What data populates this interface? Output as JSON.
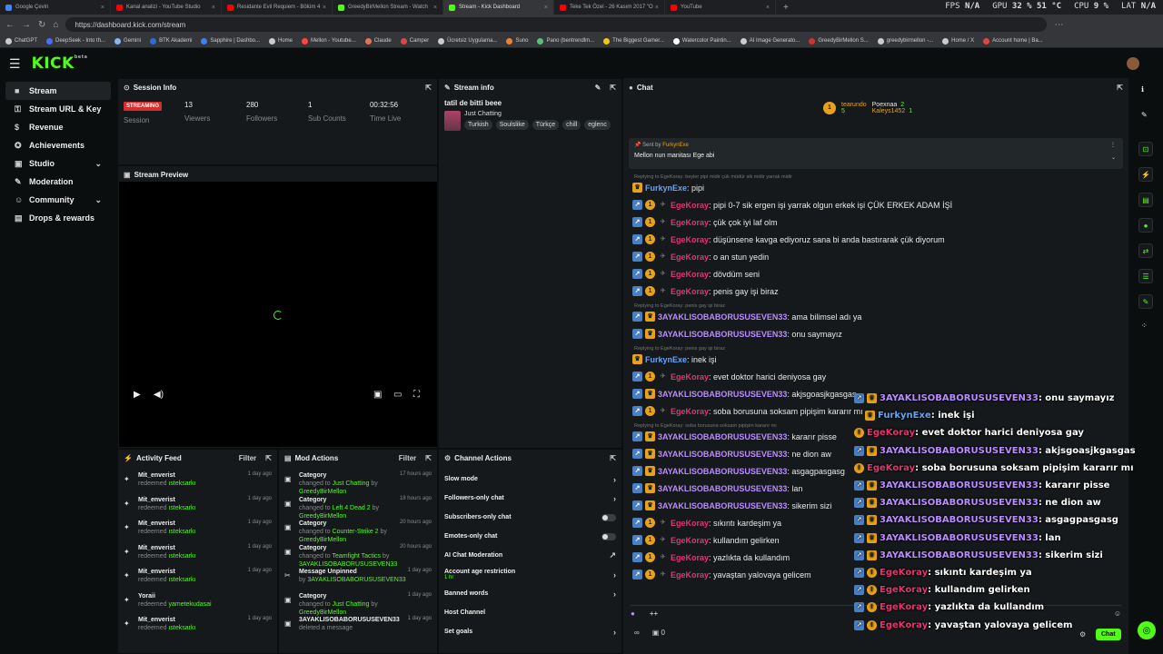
{
  "browser": {
    "tabs": [
      {
        "label": "Google Çeviri",
        "color": "#4285f4",
        "active": false
      },
      {
        "label": "Kanal analizi - YouTube Studio",
        "color": "#ff0000",
        "active": false
      },
      {
        "label": "Residante Evil Requiem - Bölüm 4",
        "color": "#ff0000",
        "active": false
      },
      {
        "label": "GreedyBirMellon Stream - Watch",
        "color": "#53fc18",
        "active": false
      },
      {
        "label": "Stream - Kick Dashboard",
        "color": "#53fc18",
        "active": true
      },
      {
        "label": "Teke Tek Özel - 26 Kasım 2017 \"O",
        "color": "#ff0000",
        "active": false
      },
      {
        "label": "YouTube",
        "color": "#ff0000",
        "active": false
      }
    ],
    "new_tab": "+",
    "url": "https://dashboard.kick.com/stream",
    "hud": {
      "fps_label": "FPS",
      "fps_value": "N/A",
      "gpu_label": "GPU",
      "gpu_value": "32 % 51 °C",
      "cpu_label": "CPU",
      "cpu_value": "9 %",
      "lat_label": "LAT",
      "lat_value": "N/A"
    },
    "bookmarks": [
      {
        "label": "ChatGPT",
        "color": "#ccc"
      },
      {
        "label": "DeepSeek - Into th...",
        "color": "#4d6bfe"
      },
      {
        "label": "Gemini",
        "color": "#8ab4f8"
      },
      {
        "label": "BTK Akademi",
        "color": "#2d6cdf"
      },
      {
        "label": "Sapphire | Dashbo...",
        "color": "#3b82f6"
      },
      {
        "label": "Home",
        "color": "#ccc"
      },
      {
        "label": "Mellon - Youtube...",
        "color": "#ff4444"
      },
      {
        "label": "Claude",
        "color": "#d97757"
      },
      {
        "label": "Camper",
        "color": "#e04545"
      },
      {
        "label": "Ücretsiz Uygulama...",
        "color": "#ccc"
      },
      {
        "label": "Suno",
        "color": "#f08030"
      },
      {
        "label": "Pano (bentrendlm...",
        "color": "#53c47b"
      },
      {
        "label": "The Biggest Gamer...",
        "color": "#f5c518"
      },
      {
        "label": "Watercolor Paintin...",
        "color": "#fff"
      },
      {
        "label": "AI Image Generato...",
        "color": "#ccc"
      },
      {
        "label": "GreedyBirMellon S...",
        "color": "#c33"
      },
      {
        "label": "greedybirmellon -...",
        "color": "#ccc"
      },
      {
        "label": "Home / X",
        "color": "#ccc"
      },
      {
        "label": "Account home | Ba...",
        "color": "#e04545"
      }
    ]
  },
  "brand": {
    "logo": "KICK",
    "logo_sup": "beta",
    "accent": "#53fc18"
  },
  "sidebar": {
    "items": [
      {
        "label": "Stream",
        "icon": "video-icon",
        "glyph": "■",
        "active": true,
        "chevron": false
      },
      {
        "label": "Stream URL & Key",
        "icon": "key-icon",
        "glyph": "⚿",
        "active": false,
        "chevron": false
      },
      {
        "label": "Revenue",
        "icon": "revenue-icon",
        "glyph": "$",
        "active": false,
        "chevron": false
      },
      {
        "label": "Achievements",
        "icon": "trophy-icon",
        "glyph": "✪",
        "active": false,
        "chevron": false
      },
      {
        "label": "Studio",
        "icon": "studio-icon",
        "glyph": "▣",
        "active": false,
        "chevron": true
      },
      {
        "label": "Moderation",
        "icon": "wrench-icon",
        "glyph": "✎",
        "active": false,
        "chevron": false
      },
      {
        "label": "Community",
        "icon": "community-icon",
        "glyph": "☺",
        "active": false,
        "chevron": true
      },
      {
        "label": "Drops & rewards",
        "icon": "gift-icon",
        "glyph": "▤",
        "active": false,
        "chevron": false
      }
    ]
  },
  "session": {
    "title": "Session Info",
    "status": "STREAMING",
    "session_label": "Session",
    "viewers": "13",
    "viewers_label": "Viewers",
    "followers": "280",
    "followers_label": "Followers",
    "subs": "1",
    "subs_label": "Sub Counts",
    "time": "00:32:56",
    "time_label": "Time Live"
  },
  "preview": {
    "title": "Stream Preview"
  },
  "stream_info": {
    "title_label": "Stream info",
    "stream_title": "tatil de bitti beee",
    "category": "Just Chatting",
    "tags": [
      "Turkish",
      "Soulslike",
      "Türkçe",
      "chill",
      "eglenc"
    ]
  },
  "activity": {
    "title": "Activity Feed",
    "filter": "Filter",
    "items": [
      {
        "name": "Mit_enverist",
        "prefix": "redeemed ",
        "item": "ısteksarkı",
        "time": "1 day ago"
      },
      {
        "name": "Mit_enverist",
        "prefix": "redeemed ",
        "item": "ısteksarkı",
        "time": "1 day ago"
      },
      {
        "name": "Mit_enverist",
        "prefix": "redeemed ",
        "item": "ısteksarkı",
        "time": "1 day ago"
      },
      {
        "name": "Mit_enverist",
        "prefix": "redeemed ",
        "item": "ısteksarkı",
        "time": "1 day ago"
      },
      {
        "name": "Mit_enverist",
        "prefix": "redeemed ",
        "item": "ısteksarkı",
        "time": "1 day ago"
      },
      {
        "name": "Yoraii",
        "prefix": "redeemed ",
        "item": "yametekudasai",
        "time": ""
      },
      {
        "name": "Mit_enverist",
        "prefix": "redeemed ",
        "item": "ısteksarkı",
        "time": "1 day ago"
      }
    ]
  },
  "mod_actions": {
    "title": "Mod Actions",
    "filter": "Filter",
    "items": [
      {
        "title": "Category",
        "prefix": "changed to ",
        "target": "Just Chatting",
        "by": " by ",
        "user": "GreedyBirMellon",
        "time": "17 hours ago"
      },
      {
        "title": "Category",
        "prefix": "changed to ",
        "target": "Left 4 Dead 2",
        "by": " by ",
        "user": "GreedyBirMellon",
        "time": "18 hours ago"
      },
      {
        "title": "Category",
        "prefix": "changed to ",
        "target": "Counter-Strike 2",
        "by": " by ",
        "user": "GreedyBirMellon",
        "time": "20 hours ago"
      },
      {
        "title": "Category",
        "prefix": "changed to ",
        "target": "Teamfight Tactics",
        "by": " by ",
        "user": "3AYAKLISOBABORUSUSEVEN33",
        "time": "20 hours ago"
      },
      {
        "title": "Message Unpinned",
        "prefix": "by ",
        "target": "",
        "by": "",
        "user": "3AYAKLISOBABORUSUSEVEN33",
        "time": "1 day ago"
      },
      {
        "title": "Category",
        "prefix": "changed to ",
        "target": "Just Chatting",
        "by": " by ",
        "user": "GreedyBirMellon",
        "time": "1 day ago"
      },
      {
        "title": "3AYAKLISOBABORUSUSEVEN33",
        "prefix": "deleted a message",
        "target": "",
        "by": "",
        "user": "",
        "time": "1 day ago"
      }
    ]
  },
  "channel_actions": {
    "title": "Channel Actions",
    "rows": [
      {
        "label": "Slow mode",
        "control": "›",
        "sub": ""
      },
      {
        "label": "Followers-only chat",
        "control": "›",
        "sub": ""
      },
      {
        "label": "Subscribers-only chat",
        "control": "toggle",
        "sub": ""
      },
      {
        "label": "Emotes-only chat",
        "control": "toggle",
        "sub": ""
      },
      {
        "label": "AI Chat Moderation",
        "control": "↗",
        "sub": ""
      },
      {
        "label": "Account age restriction",
        "control": "›",
        "sub": "1 hr"
      },
      {
        "label": "Banned words",
        "control": "›",
        "sub": ""
      },
      {
        "label": "Host Channel",
        "control": "",
        "sub": ""
      },
      {
        "label": "Set goals",
        "control": "›",
        "sub": ""
      }
    ]
  },
  "chat": {
    "title": "Chat",
    "leaders": {
      "first": {
        "name": "tearundo",
        "count": "5"
      },
      "second": {
        "name": "Poexnaa",
        "count": "2"
      },
      "third": {
        "name": "Kaleys1452",
        "count": "1"
      }
    },
    "pinned": {
      "sent_by_label": "Sent by",
      "user": "FurkynExe",
      "message": "Mellon nun manitası Ege abi"
    },
    "messages": [
      {
        "type": "reply",
        "text": "Replying to EgeKoray: beyler pipi midir çük müdür sik midir yarrak midir"
      },
      {
        "type": "msg",
        "badges": [
          "crown"
        ],
        "user": "FurkynExe",
        "cls": "u-blue",
        "text": ": pipi"
      },
      {
        "type": "msg",
        "badges": [
          "blue",
          "gold",
          "grey"
        ],
        "user": "EgeKoray",
        "cls": "u-red",
        "text": ": pipi 0-7 sik ergen işi yarrak olgun erkek işi ÇÜK ERKEK ADAM İŞİ"
      },
      {
        "type": "msg",
        "badges": [
          "blue",
          "gold",
          "grey"
        ],
        "user": "EgeKoray",
        "cls": "u-red",
        "text": ": çük çok iyi laf olm"
      },
      {
        "type": "msg",
        "badges": [
          "blue",
          "gold",
          "grey"
        ],
        "user": "EgeKoray",
        "cls": "u-red",
        "text": ": düşünsene kavga ediyoruz sana bi anda bastırarak çük diyorum"
      },
      {
        "type": "msg",
        "badges": [
          "blue",
          "gold",
          "grey"
        ],
        "user": "EgeKoray",
        "cls": "u-red",
        "text": ": o an stun yedin"
      },
      {
        "type": "msg",
        "badges": [
          "blue",
          "gold",
          "grey"
        ],
        "user": "EgeKoray",
        "cls": "u-red",
        "text": ": dövdüm seni"
      },
      {
        "type": "msg",
        "badges": [
          "blue",
          "gold",
          "grey"
        ],
        "user": "EgeKoray",
        "cls": "u-red",
        "text": ": penis gay işi biraz"
      },
      {
        "type": "reply",
        "text": "Replying to EgeKoray: penis gay işi biraz"
      },
      {
        "type": "msg",
        "badges": [
          "blue",
          "crown"
        ],
        "user": "3AYAKLISOBABORUSUSEVEN33",
        "cls": "u-purple",
        "text": ": ama bilimsel adı ya"
      },
      {
        "type": "msg",
        "badges": [
          "blue",
          "crown"
        ],
        "user": "3AYAKLISOBABORUSUSEVEN33",
        "cls": "u-purple",
        "text": ": onu saymayız"
      },
      {
        "type": "reply",
        "text": "Replying to EgeKoray: penis gay işi biraz"
      },
      {
        "type": "msg",
        "badges": [
          "crown"
        ],
        "user": "FurkynExe",
        "cls": "u-blue",
        "text": ": inek işi"
      },
      {
        "type": "msg",
        "badges": [
          "blue",
          "gold",
          "grey"
        ],
        "user": "EgeKoray",
        "cls": "u-red",
        "text": ": evet doktor harici deniyosa gay"
      },
      {
        "type": "msg",
        "badges": [
          "blue",
          "crown"
        ],
        "user": "3AYAKLISOBABORUSUSEVEN33",
        "cls": "u-purple",
        "text": ": akjsgoasjkgasgas"
      },
      {
        "type": "msg",
        "badges": [
          "blue",
          "gold",
          "grey"
        ],
        "user": "EgeKoray",
        "cls": "u-red",
        "text": ": soba borusuna soksam pipişim kararır mı"
      },
      {
        "type": "reply",
        "text": "Replying to EgeKoray: soba borusuna soksam pipişim kararır mı"
      },
      {
        "type": "msg",
        "badges": [
          "blue",
          "crown"
        ],
        "user": "3AYAKLISOBABORUSUSEVEN33",
        "cls": "u-purple",
        "text": ": kararır pisse"
      },
      {
        "type": "msg",
        "badges": [
          "blue",
          "crown"
        ],
        "user": "3AYAKLISOBABORUSUSEVEN33",
        "cls": "u-purple",
        "text": ": ne dion aw"
      },
      {
        "type": "msg",
        "badges": [
          "blue",
          "crown"
        ],
        "user": "3AYAKLISOBABORUSUSEVEN33",
        "cls": "u-purple",
        "text": ": asgagpasgasg"
      },
      {
        "type": "msg",
        "badges": [
          "blue",
          "crown"
        ],
        "user": "3AYAKLISOBABORUSUSEVEN33",
        "cls": "u-purple",
        "text": ": lan"
      },
      {
        "type": "msg",
        "badges": [
          "blue",
          "crown"
        ],
        "user": "3AYAKLISOBABORUSUSEVEN33",
        "cls": "u-purple",
        "text": ": sikerim sizi"
      },
      {
        "type": "msg",
        "badges": [
          "blue",
          "gold",
          "grey"
        ],
        "user": "EgeKoray",
        "cls": "u-red",
        "text": ": sıkıntı kardeşim ya"
      },
      {
        "type": "msg",
        "badges": [
          "blue",
          "gold",
          "grey"
        ],
        "user": "EgeKoray",
        "cls": "u-red",
        "text": ": kullandım gelirken"
      },
      {
        "type": "msg",
        "badges": [
          "blue",
          "gold",
          "grey"
        ],
        "user": "EgeKoray",
        "cls": "u-red",
        "text": ": yazlıkta da kullandım"
      },
      {
        "type": "msg",
        "badges": [
          "blue",
          "gold",
          "grey"
        ],
        "user": "EgeKoray",
        "cls": "u-red",
        "text": ": yavaştan yalovaya gelicem"
      }
    ],
    "input_text": "++",
    "viewer_count": "0",
    "send_label": "Chat"
  },
  "overlay": {
    "messages": [
      {
        "badges": [
          "blue",
          "crown"
        ],
        "user": "3AYAKLISOBABORUSUSEVEN33",
        "cls": "u-purple",
        "text": " : onu saymayız"
      },
      {
        "badges": [
          "crown"
        ],
        "user": "FurkynExe",
        "cls": "u-blue",
        "text": " : inek işi"
      },
      {
        "badges": [
          "gold"
        ],
        "user": "EgeKoray",
        "cls": "u-red",
        "text": " : evet doktor harici deniyosa gay"
      },
      {
        "badges": [
          "blue",
          "crown"
        ],
        "user": "3AYAKLISOBABORUSUSEVEN33",
        "cls": "u-purple",
        "text": " : akjsgoasjkgasgas"
      },
      {
        "badges": [
          "gold"
        ],
        "user": "EgeKoray",
        "cls": "u-red",
        "text": " : soba borusuna soksam pipişim kararır mı"
      },
      {
        "badges": [
          "blue",
          "crown"
        ],
        "user": "3AYAKLISOBABORUSUSEVEN33",
        "cls": "u-purple",
        "text": " : kararır pisse"
      },
      {
        "badges": [
          "blue",
          "crown"
        ],
        "user": "3AYAKLISOBABORUSUSEVEN33",
        "cls": "u-purple",
        "text": " : ne dion aw"
      },
      {
        "badges": [
          "blue",
          "crown"
        ],
        "user": "3AYAKLISOBABORUSUSEVEN33",
        "cls": "u-purple",
        "text": " : asgagpasgasg"
      },
      {
        "badges": [
          "blue",
          "crown"
        ],
        "user": "3AYAKLISOBABORUSUSEVEN33",
        "cls": "u-purple",
        "text": " : lan"
      },
      {
        "badges": [
          "blue",
          "crown"
        ],
        "user": "3AYAKLISOBABORUSUSEVEN33",
        "cls": "u-purple",
        "text": " : sikerim sizi"
      },
      {
        "badges": [
          "blue",
          "gold"
        ],
        "user": "EgeKoray",
        "cls": "u-red",
        "text": " : sıkıntı kardeşim ya"
      },
      {
        "badges": [
          "blue",
          "gold"
        ],
        "user": "EgeKoray",
        "cls": "u-red",
        "text": " : kullandım gelirken"
      },
      {
        "badges": [
          "blue",
          "gold"
        ],
        "user": "EgeKoray",
        "cls": "u-red",
        "text": " : yazlıkta da kullandım"
      },
      {
        "badges": [
          "blue",
          "gold"
        ],
        "user": "EgeKoray",
        "cls": "u-red",
        "text": " : yavaştan yalovaya gelicem"
      }
    ]
  }
}
